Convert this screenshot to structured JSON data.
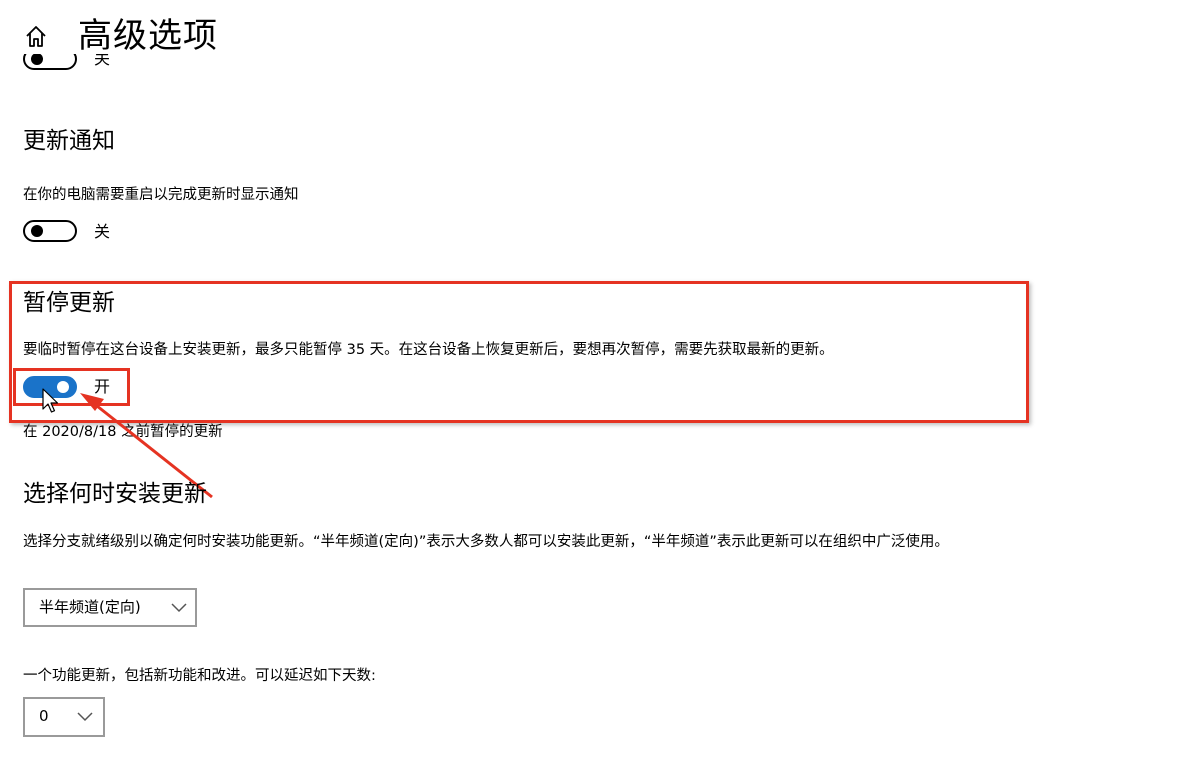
{
  "header": {
    "title": "高级选项",
    "home_icon": "home-icon"
  },
  "prev_toggle": {
    "state_label": "关",
    "state": false
  },
  "update_notification": {
    "title": "更新通知",
    "description": "在你的电脑需要重启以完成更新时显示通知",
    "toggle_state_label": "关",
    "toggle_state": false
  },
  "pause_updates": {
    "title": "暂停更新",
    "description": "要临时暂停在这台设备上安装更新，最多只能暂停 35 天。在这台设备上恢复更新后，要想再次暂停，需要先获取最新的更新。",
    "toggle_state_label": "开",
    "toggle_state": true,
    "paused_until": "在 2020/8/18 之前暂停的更新"
  },
  "choose_install": {
    "title": "选择何时安装更新",
    "description": "选择分支就绪级别以确定何时安装功能更新。“半年频道(定向)”表示大多数人都可以安装此更新，“半年频道”表示此更新可以在组织中广泛使用。",
    "branch_select_value": "半年频道(定向)",
    "deferral_description": "一个功能更新，包括新功能和改进。可以延迟如下天数:",
    "deferral_select_value": "0"
  },
  "colors": {
    "accent": "#1a73c9",
    "annotation": "#e53322",
    "select_border": "#9a9a9a"
  }
}
